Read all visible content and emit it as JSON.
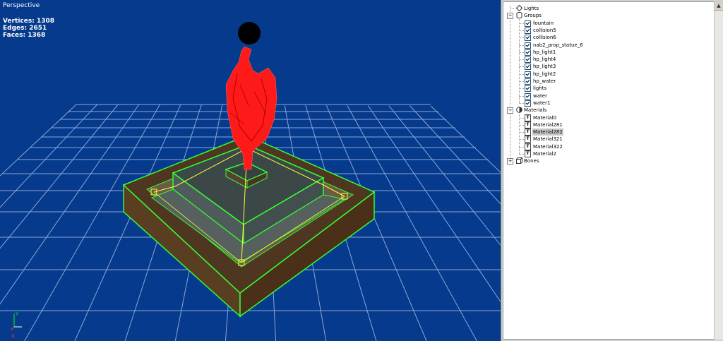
{
  "viewport": {
    "title": "Perspective",
    "stats": {
      "vertices": "Vertices: 1308",
      "edges": "Edges: 2651",
      "faces": "Faces: 1368"
    },
    "background_color": "#053a8c",
    "grid_color": "#8fa6d6",
    "selection_color": "#33ff33",
    "statue_color": "#ff1a1a"
  },
  "tree": {
    "lights": {
      "label": "Lights"
    },
    "groups": {
      "label": "Groups",
      "items": [
        {
          "label": "fountain",
          "checked": true
        },
        {
          "label": "collision5",
          "checked": true
        },
        {
          "label": "collision6",
          "checked": true
        },
        {
          "label": "nab2_prop_statue_6",
          "checked": true
        },
        {
          "label": "hp_light1",
          "checked": true
        },
        {
          "label": "hp_light4",
          "checked": true
        },
        {
          "label": "hp_light3",
          "checked": true
        },
        {
          "label": "hp_light2",
          "checked": true
        },
        {
          "label": "hp_water",
          "checked": true
        },
        {
          "label": "lights",
          "checked": true
        },
        {
          "label": "water",
          "checked": true
        },
        {
          "label": "water1",
          "checked": true
        }
      ]
    },
    "materials": {
      "label": "Materials",
      "items": [
        {
          "label": "Material0"
        },
        {
          "label": "Material281"
        },
        {
          "label": "Material282",
          "selected": true
        },
        {
          "label": "Material321"
        },
        {
          "label": "Material322"
        },
        {
          "label": "Material2"
        }
      ]
    },
    "bones": {
      "label": "Bones"
    }
  }
}
